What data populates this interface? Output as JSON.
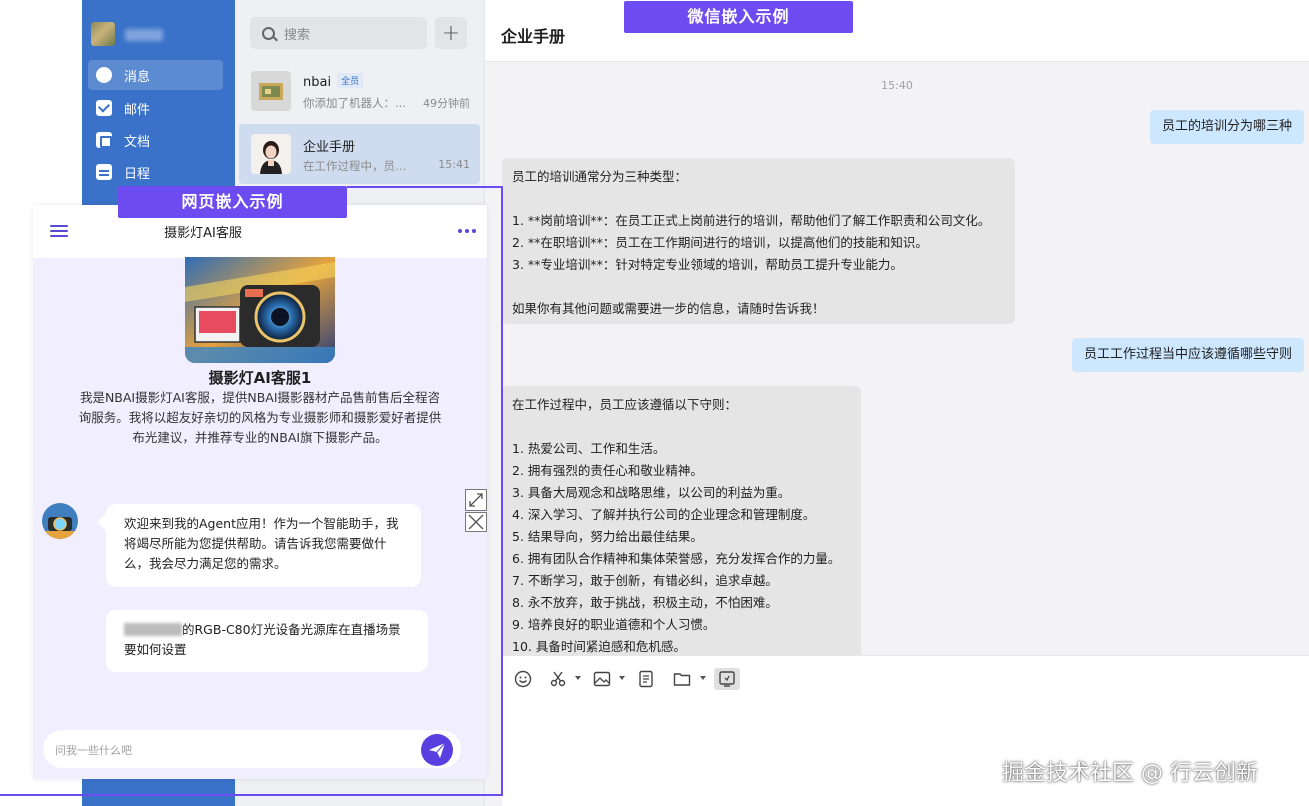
{
  "wechat": {
    "banner": "微信嵌入示例",
    "sidebar": {
      "items": [
        {
          "label": "消息",
          "icon": "message-icon"
        },
        {
          "label": "邮件",
          "icon": "mail-icon"
        },
        {
          "label": "文档",
          "icon": "document-icon"
        },
        {
          "label": "日程",
          "icon": "calendar-icon"
        }
      ]
    },
    "search": {
      "placeholder": "搜索"
    },
    "add_label": "+",
    "conversations": [
      {
        "title": "nbai",
        "badge": "全员",
        "preview": "你添加了机器人：...",
        "time": "49分钟前"
      },
      {
        "title": "企业手册",
        "preview": "在工作过程中，员工...",
        "time": "15:41"
      }
    ],
    "chat": {
      "title": "企业手册",
      "timestamp": "15:40",
      "messages": [
        {
          "from": "me",
          "text": "员工的培训分为哪三种"
        },
        {
          "from": "bot",
          "lines": [
            "员工的培训通常分为三种类型：",
            "",
            "1. **岗前培训**：在员工正式上岗前进行的培训，帮助他们了解工作职责和公司文化。",
            "2. **在职培训**：员工在工作期间进行的培训，以提高他们的技能和知识。",
            "3. **专业培训**：针对特定专业领域的培训，帮助员工提升专业能力。",
            "",
            "如果你有其他问题或需要进一步的信息，请随时告诉我！"
          ]
        },
        {
          "from": "me",
          "text": "员工工作过程当中应该遵循哪些守则"
        },
        {
          "from": "bot",
          "lines": [
            "在工作过程中，员工应该遵循以下守则：",
            "",
            "1. 热爱公司、工作和生活。",
            "2. 拥有强烈的责任心和敬业精神。",
            "3. 具备大局观念和战略思维，以公司的利益为重。",
            "4. 深入学习、了解并执行公司的企业理念和管理制度。",
            "5. 结果导向，努力给出最佳结果。",
            "6. 拥有团队合作精神和集体荣誉感，充分发挥合作的力量。",
            "7. 不断学习，敢于创新，有错必纠，追求卓越。",
            "8. 永不放弃，敢于挑战，积极主动，不怕困难。",
            "9. 培养良好的职业道德和个人习惯。",
            "10. 具备时间紧迫感和危机感。"
          ]
        }
      ]
    }
  },
  "web": {
    "banner": "网页嵌入示例",
    "title": "摄影灯AI客服",
    "bot_name": "摄影灯AI客服1",
    "bot_description": "我是NBAI摄影灯AI客服，提供NBAI摄影器材产品售前售后全程咨询服务。我将以超友好亲切的风格为专业摄影师和摄影爱好者提供布光建议，并推荐专业的NBAI旗下摄影产品。",
    "greeting": "欢迎来到我的Agent应用！作为一个智能助手，我将竭尽所能为您提供帮助。请告诉我您需要做什么，我会尽力满足您的需求。",
    "suggested_question": "的RGB-C80灯光设备光源库在直播场景要如何设置",
    "input_placeholder": "问我一些什么吧"
  },
  "watermark": "掘金技术社区 @ 行云创新"
}
